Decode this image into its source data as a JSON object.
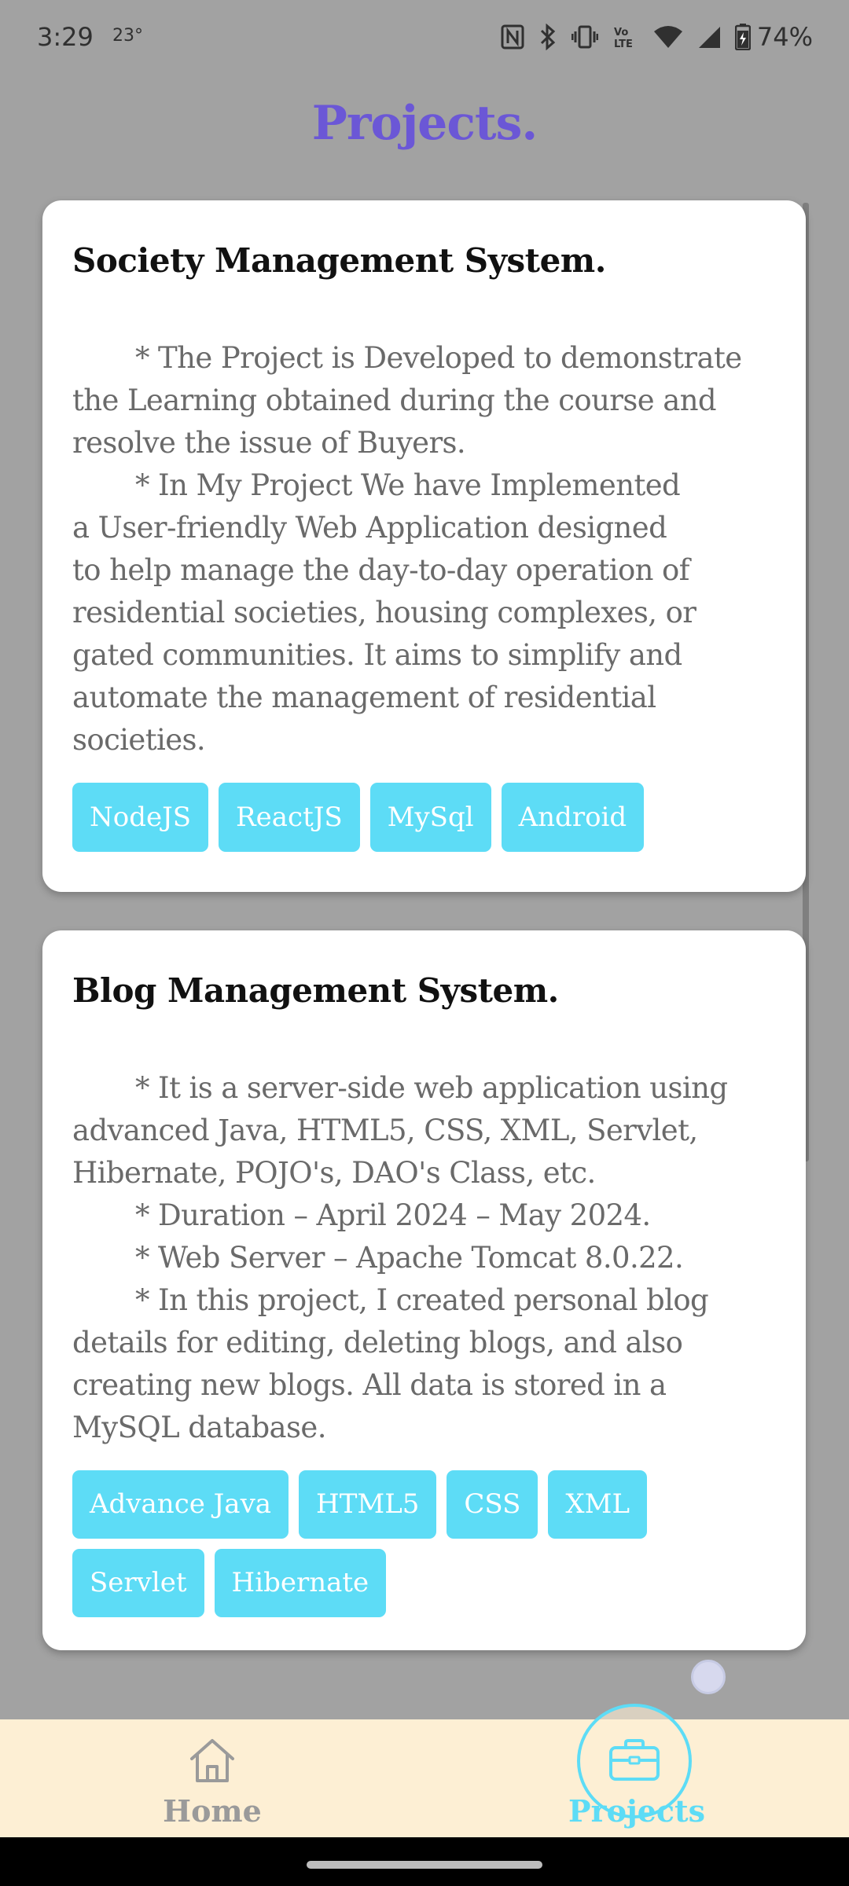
{
  "status_bar": {
    "time": "3:29",
    "temperature": "23°",
    "battery": "74%",
    "icons": [
      "nfc-icon",
      "bluetooth-icon",
      "vibrate-icon",
      "volte-icon",
      "wifi-icon",
      "signal-icon",
      "battery-icon"
    ]
  },
  "header": {
    "title": "Projects."
  },
  "projects": [
    {
      "title": "Society Management System.",
      "description_lines": [
        "* The Project is Developed to demonstrate",
        "the Learning obtained during the course and",
        "resolve the issue of Buyers.",
        "* In My Project We have Implemented",
        "a User-friendly Web Application designed",
        "to help manage the day-to-day operation of",
        "residential societies, housing complexes, or",
        "gated communities. It aims to simplify and",
        "automate the management of residential",
        "societies."
      ],
      "tags": [
        "NodeJS",
        "ReactJS",
        "MySql",
        "Android"
      ]
    },
    {
      "title": "Blog Management System.",
      "description_lines": [
        "* It is a server-side web application using",
        "advanced Java, HTML5, CSS, XML, Servlet,",
        "Hibernate, POJO's, DAO's Class, etc.",
        "* Duration – April 2024 – May 2024.",
        "* Web Server – Apache Tomcat 8.0.22.",
        "* In this project, I created personal blog",
        "details for editing, deleting blogs, and also",
        "creating new blogs. All data is stored in a",
        "MySQL database."
      ],
      "tags": [
        "Advance Java",
        "HTML5",
        "CSS",
        "XML",
        "Servlet",
        "Hibernate"
      ]
    }
  ],
  "bottom_nav": {
    "items": [
      {
        "label": "Home",
        "icon": "home-icon",
        "active": false
      },
      {
        "label": "Projects",
        "icon": "briefcase-icon",
        "active": true
      }
    ]
  },
  "colors": {
    "background": "#a2a2a2",
    "title": "#6b57d6",
    "tag": "#5ddcf6",
    "nav_background": "#fdefd4",
    "nav_active": "#5ddcf6",
    "nav_inactive": "#9a9a9a"
  }
}
